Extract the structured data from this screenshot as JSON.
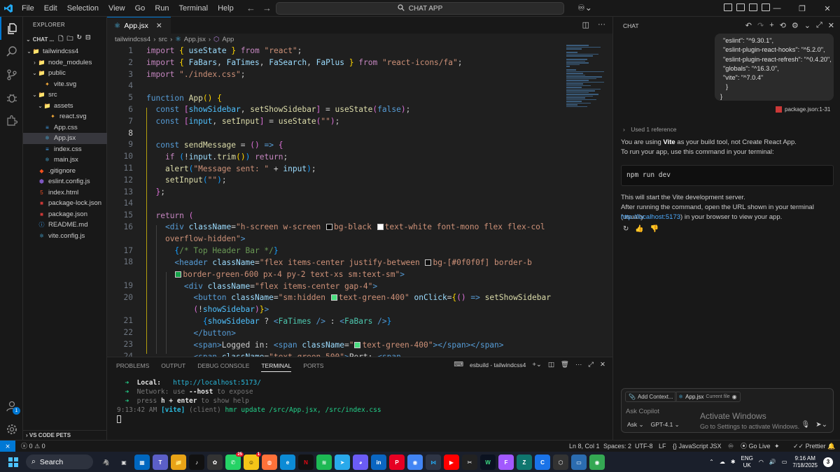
{
  "titlebar": {
    "menu": [
      "File",
      "Edit",
      "Selection",
      "View",
      "Go",
      "Run",
      "Terminal",
      "Help"
    ],
    "search": "CHAT APP"
  },
  "sidebar": {
    "title": "EXPLORER",
    "chat_label": "CHAT ...",
    "bottom": "VS CODE PETS",
    "tree": [
      {
        "label": "tailwindcss4",
        "depth": 1,
        "chev": "v",
        "icon": "folder"
      },
      {
        "label": "node_modules",
        "depth": 2,
        "chev": ">",
        "icon": "folder"
      },
      {
        "label": "public",
        "depth": 2,
        "chev": "v",
        "icon": "folder"
      },
      {
        "label": "vite.svg",
        "depth": 3,
        "chev": "",
        "icon": "svg"
      },
      {
        "label": "src",
        "depth": 2,
        "chev": "v",
        "icon": "folder"
      },
      {
        "label": "assets",
        "depth": 3,
        "chev": "v",
        "icon": "folder"
      },
      {
        "label": "react.svg",
        "depth": 4,
        "chev": "",
        "icon": "svg"
      },
      {
        "label": "App.css",
        "depth": 3,
        "chev": "",
        "icon": "css"
      },
      {
        "label": "App.jsx",
        "depth": 3,
        "chev": "",
        "icon": "react",
        "selected": true
      },
      {
        "label": "index.css",
        "depth": 3,
        "chev": "",
        "icon": "css"
      },
      {
        "label": "main.jsx",
        "depth": 3,
        "chev": "",
        "icon": "react"
      },
      {
        "label": ".gitignore",
        "depth": 2,
        "chev": "",
        "icon": "git"
      },
      {
        "label": "eslint.config.js",
        "depth": 2,
        "chev": "",
        "icon": "eslint"
      },
      {
        "label": "index.html",
        "depth": 2,
        "chev": "",
        "icon": "html"
      },
      {
        "label": "package-lock.json",
        "depth": 2,
        "chev": "",
        "icon": "npm"
      },
      {
        "label": "package.json",
        "depth": 2,
        "chev": "",
        "icon": "npm"
      },
      {
        "label": "README.md",
        "depth": 2,
        "chev": "",
        "icon": "info"
      },
      {
        "label": "vite.config.js",
        "depth": 2,
        "chev": "",
        "icon": "react"
      }
    ]
  },
  "editor": {
    "tab": "App.jsx",
    "breadcrumb": [
      "tailwindcss4",
      "src",
      "App.jsx",
      "App"
    ],
    "line_numbers": [
      "1",
      "2",
      "3",
      "4",
      "5",
      "6",
      "7",
      "8",
      "9",
      "10",
      "11",
      "12",
      "13",
      "14",
      "15",
      "16",
      "",
      "17",
      "18",
      "",
      "19",
      "20",
      "",
      "21",
      "22",
      "23",
      "24"
    ]
  },
  "panel": {
    "tabs": [
      "PROBLEMS",
      "OUTPUT",
      "DEBUG CONSOLE",
      "TERMINAL",
      "PORTS"
    ],
    "active_tab": "TERMINAL",
    "terminal_name": "esbuild - tailwindcss4",
    "local_label": "Local:",
    "local_url": "http://localhost:5173/",
    "network_label": "Network:",
    "network_text": "use",
    "network_flag": "--host",
    "network_rest": "to expose",
    "help_press": "press",
    "help_key": "h + enter",
    "help_rest": "to show help",
    "hmr_time": "9:13:42 AM",
    "hmr_tag": "[vite]",
    "hmr_client": "(client)",
    "hmr_msg": "hmr update /src/App.jsx, /src/index.css"
  },
  "chat": {
    "title": "CHAT",
    "json_lines": [
      "\"eslint\": \"^9.30.1\",",
      "\"eslint-plugin-react-hooks\": \"^5.2.0\",",
      "\"eslint-plugin-react-refresh\": \"^0.4.20\",",
      "\"globals\": \"^16.3.0\",",
      "\"vite\": \"^7.0.4\"",
      "}",
      "}"
    ],
    "ref": "package.json:1-31",
    "used_ref": "Used 1 reference",
    "p1_a": "You are using ",
    "p1_bold": "Vite",
    "p1_b": " as your build tool, not Create React App.",
    "p2": "To run your app, use this command in your terminal:",
    "command": "npm run dev",
    "p3": "This will start the Vite development server.",
    "p4": "After running the command, open the URL shown in your terminal (usually",
    "link": "http://localhost:5173",
    "p5": ") in your browser to view your app.",
    "add_context": "Add Context...",
    "file_chip": "App.jsx",
    "file_chip_sub": "Current file",
    "placeholder": "Ask Copilot",
    "mode": "Ask",
    "model": "GPT-4.1"
  },
  "watermark": {
    "title": "Activate Windows",
    "sub": "Go to Settings to activate Windows."
  },
  "status": {
    "errors": "0",
    "warnings": "0",
    "position": "Ln 8, Col 1",
    "spaces": "Spaces: 2",
    "encoding": "UTF-8",
    "eol": "LF",
    "language": "JavaScript JSX",
    "golive": "Go Live",
    "prettier": "Prettier"
  },
  "taskbar": {
    "search": "Search",
    "lang1": "ENG",
    "lang2": "UK",
    "time": "9:16 AM",
    "date": "7/18/2025",
    "notifications": "3",
    "badge_whatsapp": "25",
    "badge_other": "1"
  }
}
